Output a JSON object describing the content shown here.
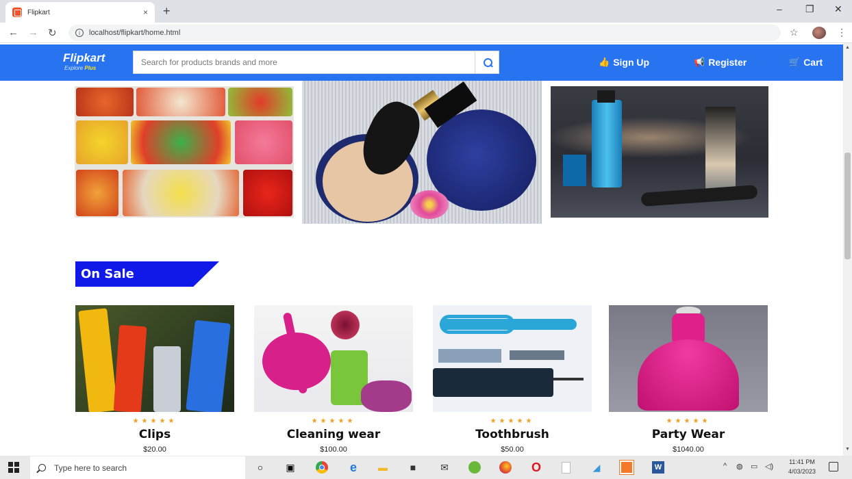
{
  "browser": {
    "tab_title": "Flipkart",
    "tab_close": "×",
    "new_tab": "+",
    "url": "localhost/flipkart/home.html",
    "window_controls": [
      "–",
      "❐",
      "✕"
    ]
  },
  "header": {
    "logo": "Flipkart",
    "logo_sub_a": "Explore",
    "logo_sub_b": "Plus",
    "search_placeholder": "Search for products brands and more",
    "nav": {
      "signup": "Sign Up",
      "register": "Register",
      "cart": "Cart"
    }
  },
  "section": {
    "title": "On Sale"
  },
  "products": [
    {
      "name": "Clips",
      "price": "$20.00",
      "rating": 5
    },
    {
      "name": "Cleaning wear",
      "price": "$100.00",
      "rating": 5
    },
    {
      "name": "Toothbrush",
      "price": "$50.00",
      "rating": 5
    },
    {
      "name": "Party Wear",
      "price": "$1040.00",
      "rating": 5
    }
  ],
  "taskbar": {
    "search_placeholder": "Type here to search",
    "time": "11:41 PM",
    "date": "4/03/2023"
  },
  "colors": {
    "brand_blue": "#2874f0",
    "sale_blue": "#1119e8",
    "star_orange": "#f0a020"
  }
}
